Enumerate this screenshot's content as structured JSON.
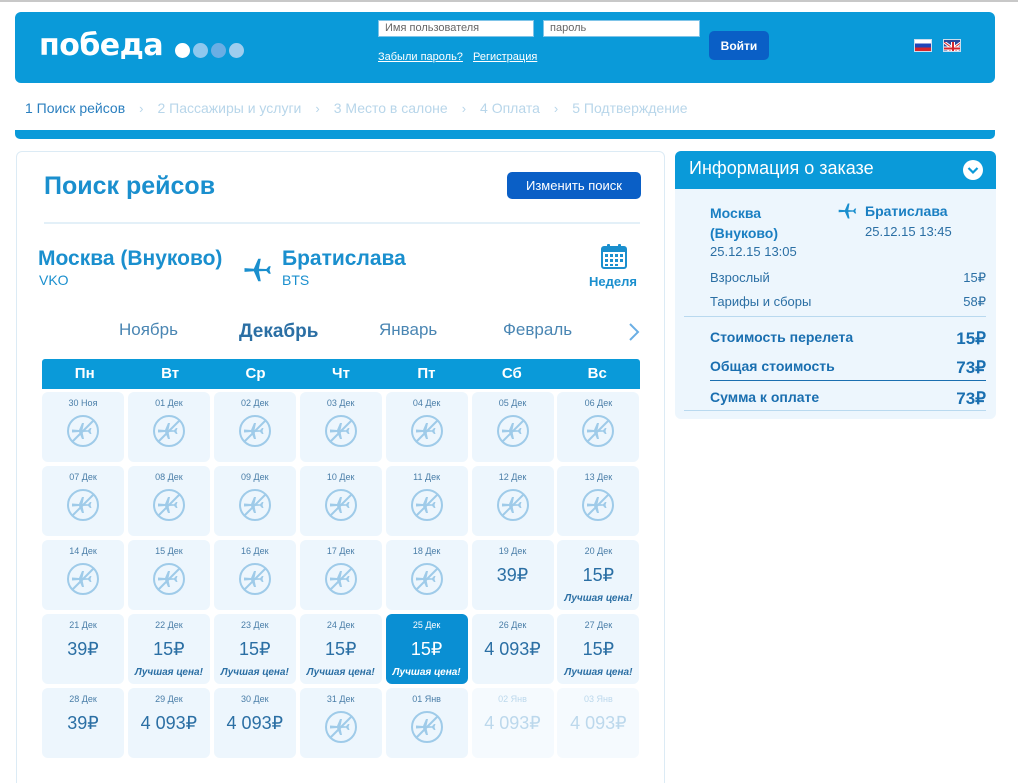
{
  "header": {
    "logo_text": "победа",
    "logo_dot_colors": [
      "#ffffff",
      "#8ec8ee",
      "#6aaee4",
      "#9fcdee"
    ],
    "username_placeholder": "Имя пользователя",
    "password_placeholder": "пароль",
    "forgot_label": "Забыли пароль?",
    "register_label": "Регистрация",
    "login_label": "Войти"
  },
  "steps": [
    "1 Поиск рейсов",
    "2 Пассажиры и услуги",
    "3 Место в салоне",
    "4 Оплата",
    "5 Подтверждение"
  ],
  "steps_separator": "›",
  "search": {
    "title": "Поиск рейсов",
    "change_label": "Изменить поиск",
    "from_city": "Москва (Внуково)",
    "from_code": "VKO",
    "to_city": "Братислава",
    "to_code": "BTS",
    "week_label": "Неделя"
  },
  "months": [
    "Ноябрь",
    "Декабрь",
    "Январь",
    "Февраль"
  ],
  "weekdays": [
    "Пн",
    "Вт",
    "Ср",
    "Чт",
    "Пт",
    "Сб",
    "Вс"
  ],
  "calendar": [
    {
      "date": "30 Ноя",
      "price": null,
      "best": null,
      "state": "none"
    },
    {
      "date": "01 Дек",
      "price": null,
      "best": null,
      "state": "none"
    },
    {
      "date": "02 Дек",
      "price": null,
      "best": null,
      "state": "none"
    },
    {
      "date": "03 Дек",
      "price": null,
      "best": null,
      "state": "none"
    },
    {
      "date": "04 Дек",
      "price": null,
      "best": null,
      "state": "none"
    },
    {
      "date": "05 Дек",
      "price": null,
      "best": null,
      "state": "none"
    },
    {
      "date": "06 Дек",
      "price": null,
      "best": null,
      "state": "none"
    },
    {
      "date": "07 Дек",
      "price": null,
      "best": null,
      "state": "none"
    },
    {
      "date": "08 Дек",
      "price": null,
      "best": null,
      "state": "none"
    },
    {
      "date": "09 Дек",
      "price": null,
      "best": null,
      "state": "none"
    },
    {
      "date": "10 Дек",
      "price": null,
      "best": null,
      "state": "none"
    },
    {
      "date": "11 Дек",
      "price": null,
      "best": null,
      "state": "none"
    },
    {
      "date": "12 Дек",
      "price": null,
      "best": null,
      "state": "none"
    },
    {
      "date": "13 Дек",
      "price": null,
      "best": null,
      "state": "none"
    },
    {
      "date": "14 Дек",
      "price": null,
      "best": null,
      "state": "none"
    },
    {
      "date": "15 Дек",
      "price": null,
      "best": null,
      "state": "none"
    },
    {
      "date": "16 Дек",
      "price": null,
      "best": null,
      "state": "none"
    },
    {
      "date": "17 Дек",
      "price": null,
      "best": null,
      "state": "none"
    },
    {
      "date": "18 Дек",
      "price": null,
      "best": null,
      "state": "none"
    },
    {
      "date": "19 Дек",
      "price": "39₽",
      "best": null,
      "state": "price"
    },
    {
      "date": "20 Дек",
      "price": "15₽",
      "best": "Лучшая цена!",
      "state": "price"
    },
    {
      "date": "21 Дек",
      "price": "39₽",
      "best": null,
      "state": "price"
    },
    {
      "date": "22 Дек",
      "price": "15₽",
      "best": "Лучшая цена!",
      "state": "price"
    },
    {
      "date": "23 Дек",
      "price": "15₽",
      "best": "Лучшая цена!",
      "state": "price"
    },
    {
      "date": "24 Дек",
      "price": "15₽",
      "best": "Лучшая цена!",
      "state": "price"
    },
    {
      "date": "25 Дек",
      "price": "15₽",
      "best": "Лучшая цена!",
      "state": "selected"
    },
    {
      "date": "26 Дек",
      "price": "4 093₽",
      "best": null,
      "state": "price"
    },
    {
      "date": "27 Дек",
      "price": "15₽",
      "best": "Лучшая цена!",
      "state": "price"
    },
    {
      "date": "28 Дек",
      "price": "39₽",
      "best": null,
      "state": "price"
    },
    {
      "date": "29 Дек",
      "price": "4 093₽",
      "best": null,
      "state": "price"
    },
    {
      "date": "30 Дек",
      "price": "4 093₽",
      "best": null,
      "state": "price"
    },
    {
      "date": "31 Дек",
      "price": null,
      "best": null,
      "state": "none"
    },
    {
      "date": "01 Янв",
      "price": null,
      "best": null,
      "state": "none"
    },
    {
      "date": "02 Янв",
      "price": "4 093₽",
      "best": null,
      "state": "faded"
    },
    {
      "date": "03 Янв",
      "price": "4 093₽",
      "best": null,
      "state": "faded"
    }
  ],
  "order": {
    "title": "Информация о заказе",
    "from_city_line1": "Москва",
    "from_city_line2": "(Внуково)",
    "from_datetime": "25.12.15 13:05",
    "to_city": "Братислава",
    "to_datetime": "25.12.15 13:45",
    "adult_label": "Взрослый",
    "adult_value": "15₽",
    "fees_label": "Тарифы и сборы",
    "fees_value": "58₽",
    "flight_cost_label": "Стоимость перелета",
    "flight_cost_value": "15₽",
    "total_label": "Общая стоимость",
    "total_value": "73₽",
    "pay_label": "Сумма к оплате",
    "pay_value": "73₽"
  },
  "colors": {
    "brand_blue": "#0a9ad9",
    "button_blue": "#0a5fc6",
    "text_blue": "#1a8fce",
    "cell_bg": "#edf6fd"
  }
}
